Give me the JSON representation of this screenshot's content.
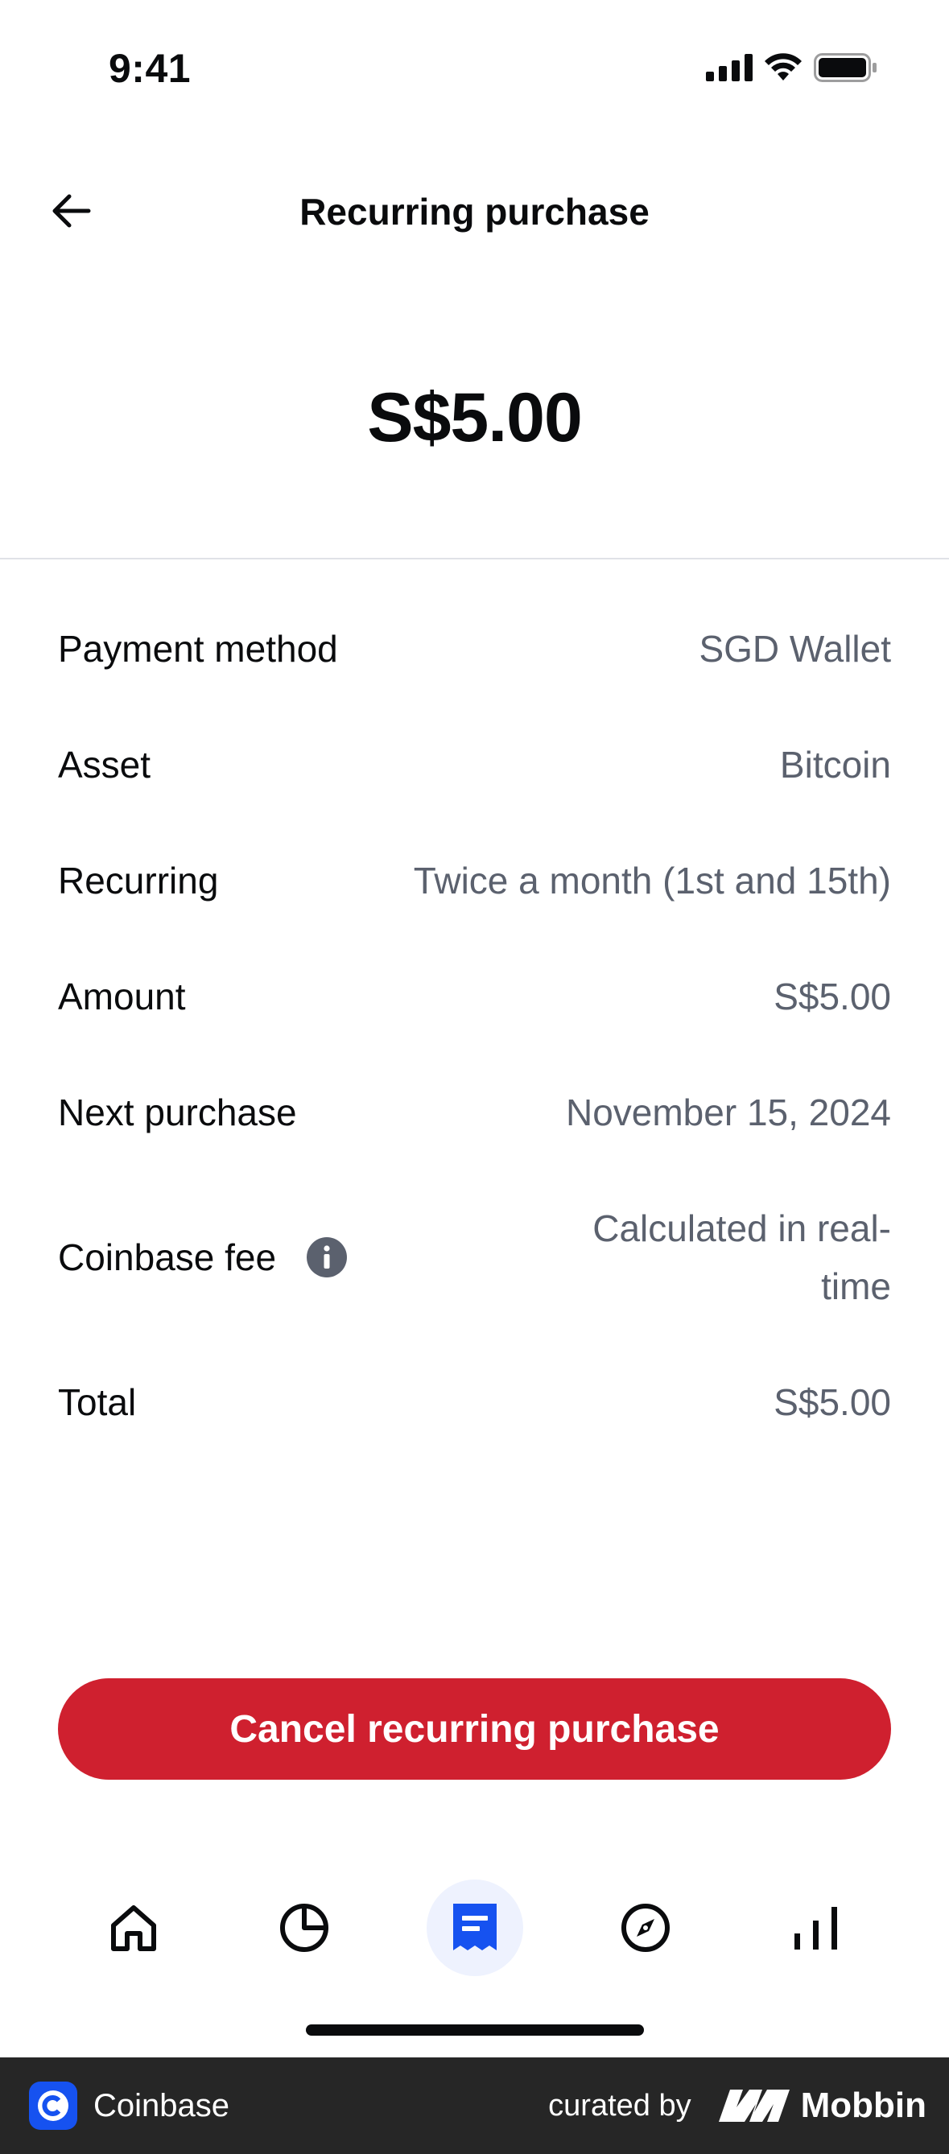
{
  "status_bar": {
    "time": "9:41"
  },
  "header": {
    "title": "Recurring purchase"
  },
  "hero": {
    "amount": "S$5.00"
  },
  "details": [
    {
      "label": "Payment method",
      "value": "SGD Wallet"
    },
    {
      "label": "Asset",
      "value": "Bitcoin"
    },
    {
      "label": "Recurring",
      "value": "Twice a month (1st and 15th)"
    },
    {
      "label": "Amount",
      "value": "S$5.00"
    },
    {
      "label": "Next purchase",
      "value": "November 15, 2024"
    },
    {
      "label": "Coinbase fee",
      "value": "Calculated in real-time",
      "value_line1": "Calculated in real-",
      "value_line2": "time"
    },
    {
      "label": "Total",
      "value": "S$5.00"
    }
  ],
  "cancel_button": {
    "label": "Cancel recurring purchase"
  },
  "tabs": [
    {
      "icon": "home-icon"
    },
    {
      "icon": "portfolio-pie-icon"
    },
    {
      "icon": "transactions-receipt-icon",
      "active": true
    },
    {
      "icon": "explore-compass-icon"
    },
    {
      "icon": "markets-chart-icon"
    }
  ],
  "footer": {
    "app_name": "Coinbase",
    "curated_by": "curated by",
    "brand": "Mobbin"
  },
  "colors": {
    "accent_blue": "#1652f0",
    "danger_red": "#cf202f",
    "text_secondary": "#5b616e"
  }
}
